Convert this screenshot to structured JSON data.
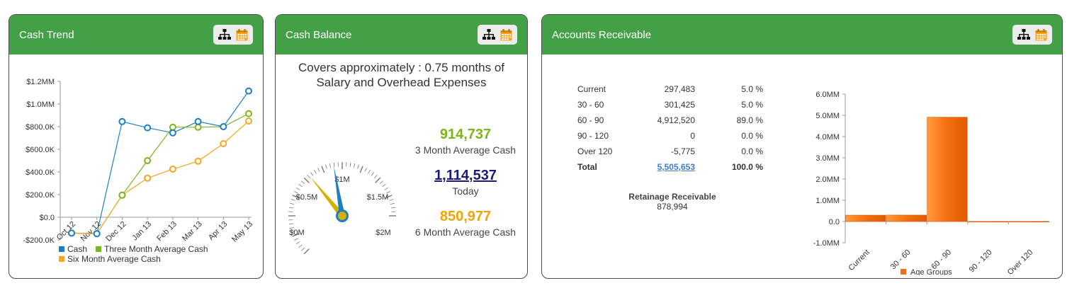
{
  "panels": {
    "cash_trend": {
      "title": "Cash Trend",
      "icons": [
        "hierarchy-icon",
        "calendar-icon"
      ],
      "legend": [
        "Cash",
        "Three Month Average Cash",
        "Six Month Average Cash"
      ]
    },
    "cash_balance": {
      "title": "Cash Balance",
      "covers_line1": "Covers approximately : 0.75 months of",
      "covers_line2": "Salary and Overhead Expenses",
      "metrics": [
        {
          "value": "914,737",
          "label": "3 Month Average Cash",
          "color": "#7cb518"
        },
        {
          "value": "1,114,537",
          "label": "Today",
          "color": "#1a1a7a"
        },
        {
          "value": "850,977",
          "label": "6 Month Average Cash",
          "color": "#f0a500"
        }
      ],
      "gauge_labels": [
        "$0M",
        "$0.5M",
        "$1M",
        "$1.5M",
        "$2M"
      ]
    },
    "accounts_receivable": {
      "title": "Accounts Receivable",
      "rows": [
        {
          "label": "Current",
          "amount": "297,483",
          "pct": "5.0 %"
        },
        {
          "label": "30 - 60",
          "amount": "301,425",
          "pct": "5.0 %"
        },
        {
          "label": "60 - 90",
          "amount": "4,912,520",
          "pct": "89.0 %"
        },
        {
          "label": "90 - 120",
          "amount": "0",
          "pct": "0.0 %"
        },
        {
          "label": "Over 120",
          "amount": "-5,775",
          "pct": "0.0 %"
        }
      ],
      "total": {
        "label": "Total",
        "amount": "5,505,653",
        "pct": "100.0 %"
      },
      "retainage_title": "Retainage Receivable",
      "retainage_value": "878,994",
      "legend": "Age Groups"
    }
  },
  "colors": {
    "header_green": "#43a047",
    "cash_blue": "#1b7fc4",
    "three_month_green": "#7cb518",
    "six_month_orange": "#f5a623",
    "bar_orange": "#f36f12",
    "gauge_needle_blue": "#1b7fc4",
    "gauge_needle_gold": "#d4b000"
  },
  "chart_data": [
    {
      "type": "line",
      "title": "",
      "x": [
        "Oct 12",
        "Nov 12",
        "Dec 12",
        "Jan 13",
        "Feb 13",
        "Mar 13",
        "Apr 13",
        "May 13"
      ],
      "ylim": [
        -200000,
        1200000
      ],
      "yticks": [
        "-$200.0K",
        "$0.0",
        "$200.0K",
        "$400.0K",
        "$600.0K",
        "$800.0K",
        "$1.0MM",
        "$1.2MM"
      ],
      "ytick_values": [
        -200000,
        0,
        200000,
        400000,
        600000,
        800000,
        1000000,
        1200000
      ],
      "series": [
        {
          "name": "Cash",
          "color": "#1b7fc4",
          "values": [
            -140000,
            -145000,
            845000,
            790000,
            745000,
            845000,
            800000,
            1115000
          ]
        },
        {
          "name": "Three Month Average Cash",
          "color": "#7cb518",
          "values": [
            -140000,
            -145000,
            195000,
            500000,
            795000,
            795000,
            800000,
            915000
          ]
        },
        {
          "name": "Six Month Average Cash",
          "color": "#f5a623",
          "values": [
            -140000,
            -145000,
            195000,
            345000,
            425000,
            495000,
            650000,
            850000
          ]
        }
      ]
    },
    {
      "type": "gauge",
      "min": 0,
      "max": 2000000,
      "tick_labels": [
        "$0M",
        "$0.5M",
        "$1M",
        "$1.5M",
        "$2M"
      ],
      "tick_values": [
        0,
        500000,
        1000000,
        1500000,
        2000000
      ],
      "needles": [
        {
          "name": "Today",
          "value": 1114537,
          "color": "#1b7fc4"
        },
        {
          "name": "6 Month Average Cash",
          "value": 850977,
          "color": "#d4b000"
        }
      ]
    },
    {
      "type": "bar",
      "categories": [
        "Current",
        "30 - 60",
        "60 - 90",
        "90 - 120",
        "Over 120"
      ],
      "values": [
        297483,
        301425,
        4912520,
        0,
        -5775
      ],
      "ylim": [
        -1000000,
        6000000
      ],
      "yticks": [
        "-1.0MM",
        "0.0",
        "1.0MM",
        "2.0MM",
        "3.0MM",
        "4.0MM",
        "5.0MM",
        "6.0MM"
      ],
      "ytick_values": [
        -1000000,
        0,
        1000000,
        2000000,
        3000000,
        4000000,
        5000000,
        6000000
      ],
      "legend": "Age Groups",
      "color": "#f36f12"
    }
  ]
}
